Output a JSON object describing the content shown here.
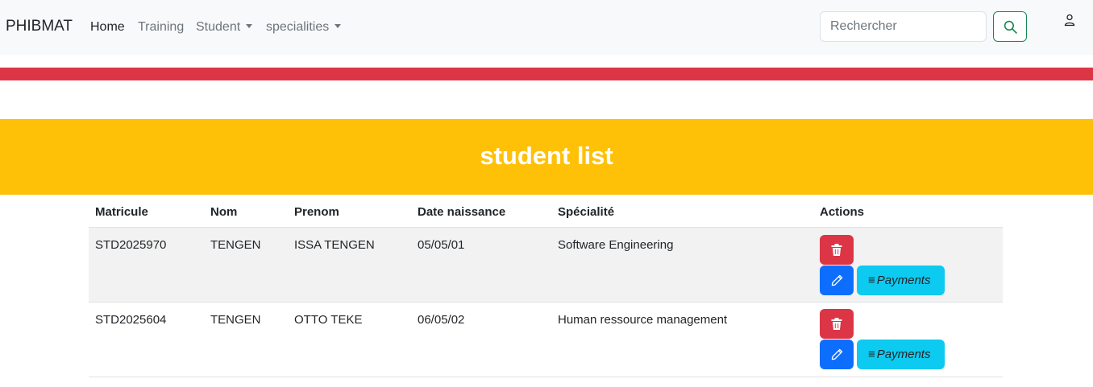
{
  "navbar": {
    "brand": "PHIBMAT",
    "links": [
      {
        "label": "Home"
      },
      {
        "label": "Training"
      },
      {
        "label": "Student"
      },
      {
        "label": "specialities"
      }
    ],
    "search_placeholder": "Rechercher",
    "search_icon": "search-icon",
    "user_icon": "user-icon"
  },
  "banner": {
    "title": "student list"
  },
  "table": {
    "headers": [
      "Matricule",
      "Nom",
      "Prenom",
      "Date naissance",
      "Spécialité",
      "Actions"
    ],
    "rows": [
      {
        "matricule": "STD2025970",
        "nom": "TENGEN",
        "prenom": "ISSA TENGEN",
        "date": "05/05/01",
        "specialite": "Software Engineering"
      },
      {
        "matricule": "STD2025604",
        "nom": "TENGEN",
        "prenom": "OTTO TEKE",
        "date": "06/05/02",
        "specialite": "Human ressource management"
      }
    ],
    "actions": {
      "payments_label": "Payments"
    }
  },
  "colors": {
    "navbar_bg": "#f8f9fa",
    "red_bar": "#dc3545",
    "banner_bg": "#ffc107",
    "delete_button": "#dc3545",
    "edit_button": "#0d6efd",
    "payments_button": "#0dcaf0",
    "search_button_border": "#198754"
  }
}
